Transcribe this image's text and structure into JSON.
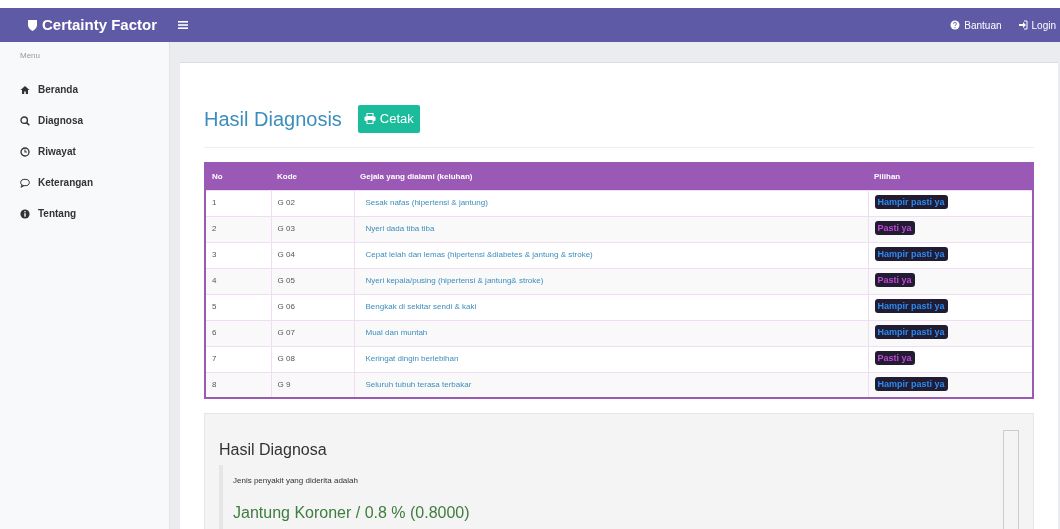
{
  "navbar": {
    "brand": "Certainty Factor",
    "links": [
      {
        "label": "Bantuan"
      },
      {
        "label": "Login"
      }
    ]
  },
  "sidebar": {
    "heading": "Menu",
    "items": [
      {
        "label": "Beranda"
      },
      {
        "label": "Diagnosa"
      },
      {
        "label": "Riwayat"
      },
      {
        "label": "Keterangan"
      },
      {
        "label": "Tentang"
      }
    ]
  },
  "page": {
    "title": "Hasil Diagnosis",
    "print_button": "Cetak"
  },
  "table": {
    "columns": [
      "No",
      "Kode",
      "Gejala yang dialami (keluhan)",
      "Pilihan"
    ],
    "rows": [
      {
        "no": "1",
        "kode": "G 02",
        "gejala": "Sesak nafas (hipertensi & jantung)",
        "pilihan": "Hampir pasti ya",
        "kind": "probable"
      },
      {
        "no": "2",
        "kode": "G 03",
        "gejala": "Nyeri dada tiba tiba",
        "pilihan": "Pasti ya",
        "kind": "certain"
      },
      {
        "no": "3",
        "kode": "G 04",
        "gejala": "Cepat lelah dan lemas (hipertensi &diabetes & jantung & stroke)",
        "pilihan": "Hampir pasti ya",
        "kind": "probable"
      },
      {
        "no": "4",
        "kode": "G 05",
        "gejala": "Nyeri kepala/pusing (hipertensi & jantung& stroke)",
        "pilihan": "Pasti ya",
        "kind": "certain"
      },
      {
        "no": "5",
        "kode": "G 06",
        "gejala": "Bengkak di sekitar sendi & kaki",
        "pilihan": "Hampir pasti ya",
        "kind": "probable"
      },
      {
        "no": "6",
        "kode": "G 07",
        "gejala": "Mual dan muntah",
        "pilihan": "Hampir pasti ya",
        "kind": "probable"
      },
      {
        "no": "7",
        "kode": "G 08",
        "gejala": "Keringat dingin berlebihan",
        "pilihan": "Pasti ya",
        "kind": "certain"
      },
      {
        "no": "8",
        "kode": "G 9",
        "gejala": "Seluruh tubuh terasa terbakar",
        "pilihan": "Hampir pasti ya",
        "kind": "probable"
      }
    ]
  },
  "result": {
    "title": "Hasil Diagnosa",
    "lead": "Jenis penyakit yang diderita adalah",
    "diagnosis": "Jantung Koroner / 0.8 % (0.8000)"
  }
}
